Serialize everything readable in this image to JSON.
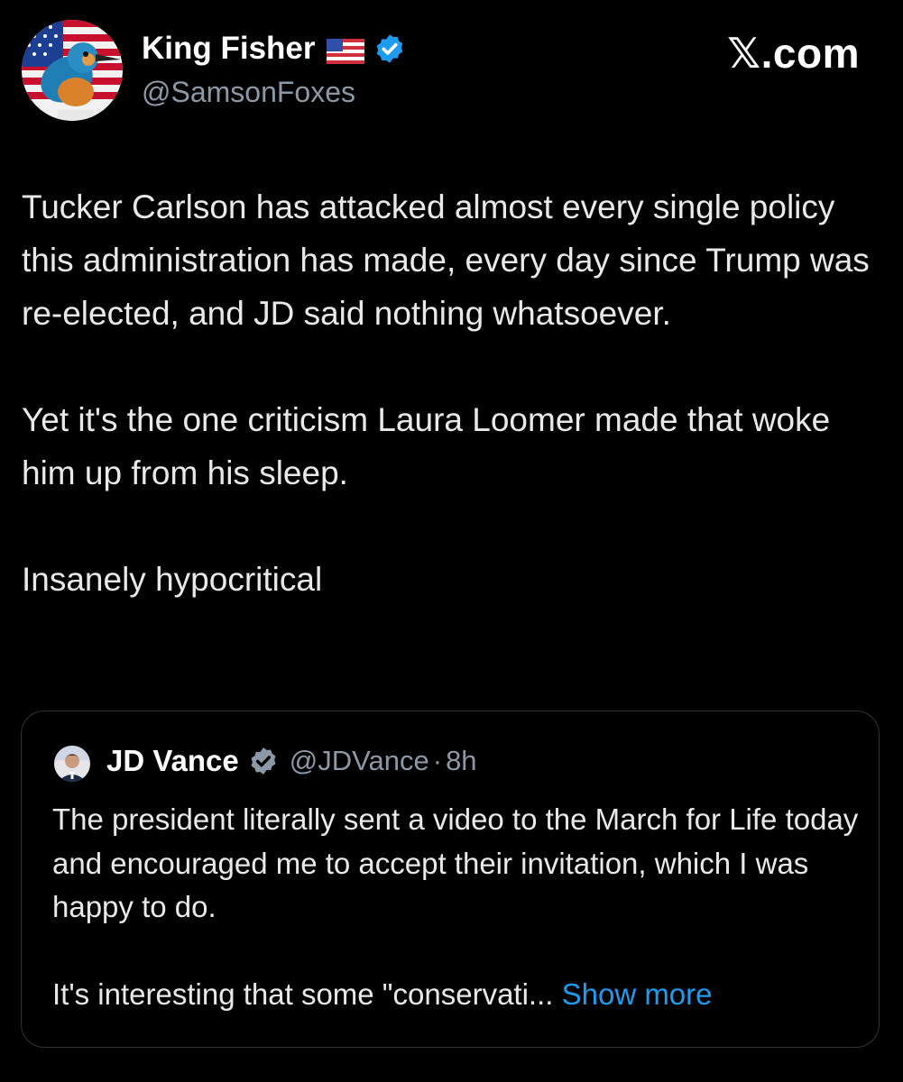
{
  "post": {
    "author": {
      "name": "King Fisher",
      "handle": "@SamsonFoxes",
      "flag_icon": "us-flag-icon",
      "verified_icon": "verified-badge-icon"
    },
    "site_mark": "𝕏.com",
    "paragraphs": [
      "Tucker Carlson has attacked almost every single policy this administration has made, every day since Trump was re-elected, and JD said nothing whatsoever.",
      "Yet it's the one criticism Laura Loomer made that woke him up from his sleep.",
      "Insanely hypocritical"
    ]
  },
  "quote": {
    "author": {
      "name": "JD Vance",
      "handle": "@JDVance",
      "separator": "·",
      "time": "8h"
    },
    "paragraphs": [
      "The president literally sent a video to the March for Life today and encouraged me to accept their invitation, which I was happy to do.",
      "It's interesting that some \"conservati..."
    ],
    "show_more_label": " Show more"
  },
  "colors": {
    "background": "#000000",
    "text_primary": "#e7e9ea",
    "text_secondary": "#8b98a5",
    "link_blue": "#1d9bf0",
    "verified_blue": "#1d9bf0",
    "card_border": "#2f3336"
  }
}
